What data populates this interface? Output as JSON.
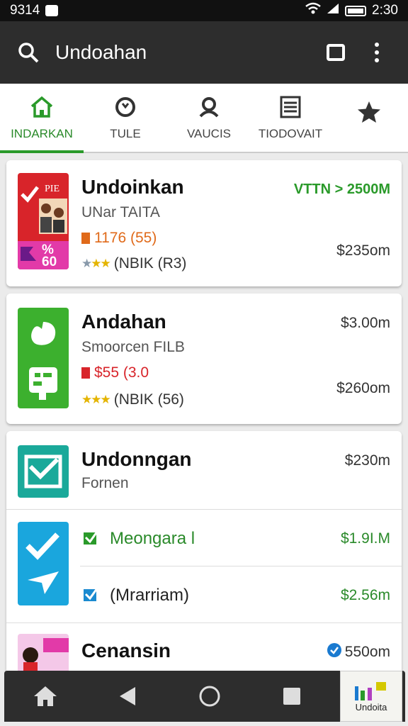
{
  "status_bar": {
    "left_text": "9314",
    "time": "2:30"
  },
  "app_bar": {
    "title": "Undoahan",
    "icons": [
      "search-icon",
      "square-icon",
      "more-vert-icon"
    ]
  },
  "tabs": [
    {
      "label": "INDARKAN",
      "icon": "home-icon",
      "active": true
    },
    {
      "label": "TULE",
      "icon": "clock-icon"
    },
    {
      "label": "VAUCIS",
      "icon": "person-icon"
    },
    {
      "label": "TIODOVAIT",
      "icon": "list-icon"
    },
    {
      "label": "",
      "icon": "star-icon"
    }
  ],
  "items": [
    {
      "name": "Undoinkan",
      "sub": "UNar TAITA",
      "highlight": "VTTN > 2500M",
      "price_line": "1176 (55)",
      "price": "$235om",
      "rating": "(NBIK (R3)",
      "thumb_text": "%\n60"
    },
    {
      "name": "Andahan",
      "sub": "Smoorcen FILB",
      "top_price": "$3.00m",
      "price_line": "$55 (3.0",
      "price": "$260om",
      "rating": "(NBIK (56)"
    },
    {
      "name": "Undonngan",
      "sub": "Fornen",
      "price": "$230m"
    },
    {
      "name": "Meongara l",
      "price": "$1.9I.M"
    },
    {
      "name": "(Mrarriam)",
      "price": "$2.56m"
    },
    {
      "name": "Cenansin",
      "price": "550om"
    }
  ],
  "nav_bar": {
    "icons": [
      "home-icon",
      "back-icon",
      "circle-home-icon",
      "square-recents-icon"
    ],
    "brand": "Undoita"
  },
  "colors": {
    "accent_green": "#2a9a2a",
    "red": "#d8242a",
    "orange": "#e06a1a",
    "purple": "#b040c0",
    "teal": "#1aa99a",
    "blue": "#1aa6dd"
  }
}
